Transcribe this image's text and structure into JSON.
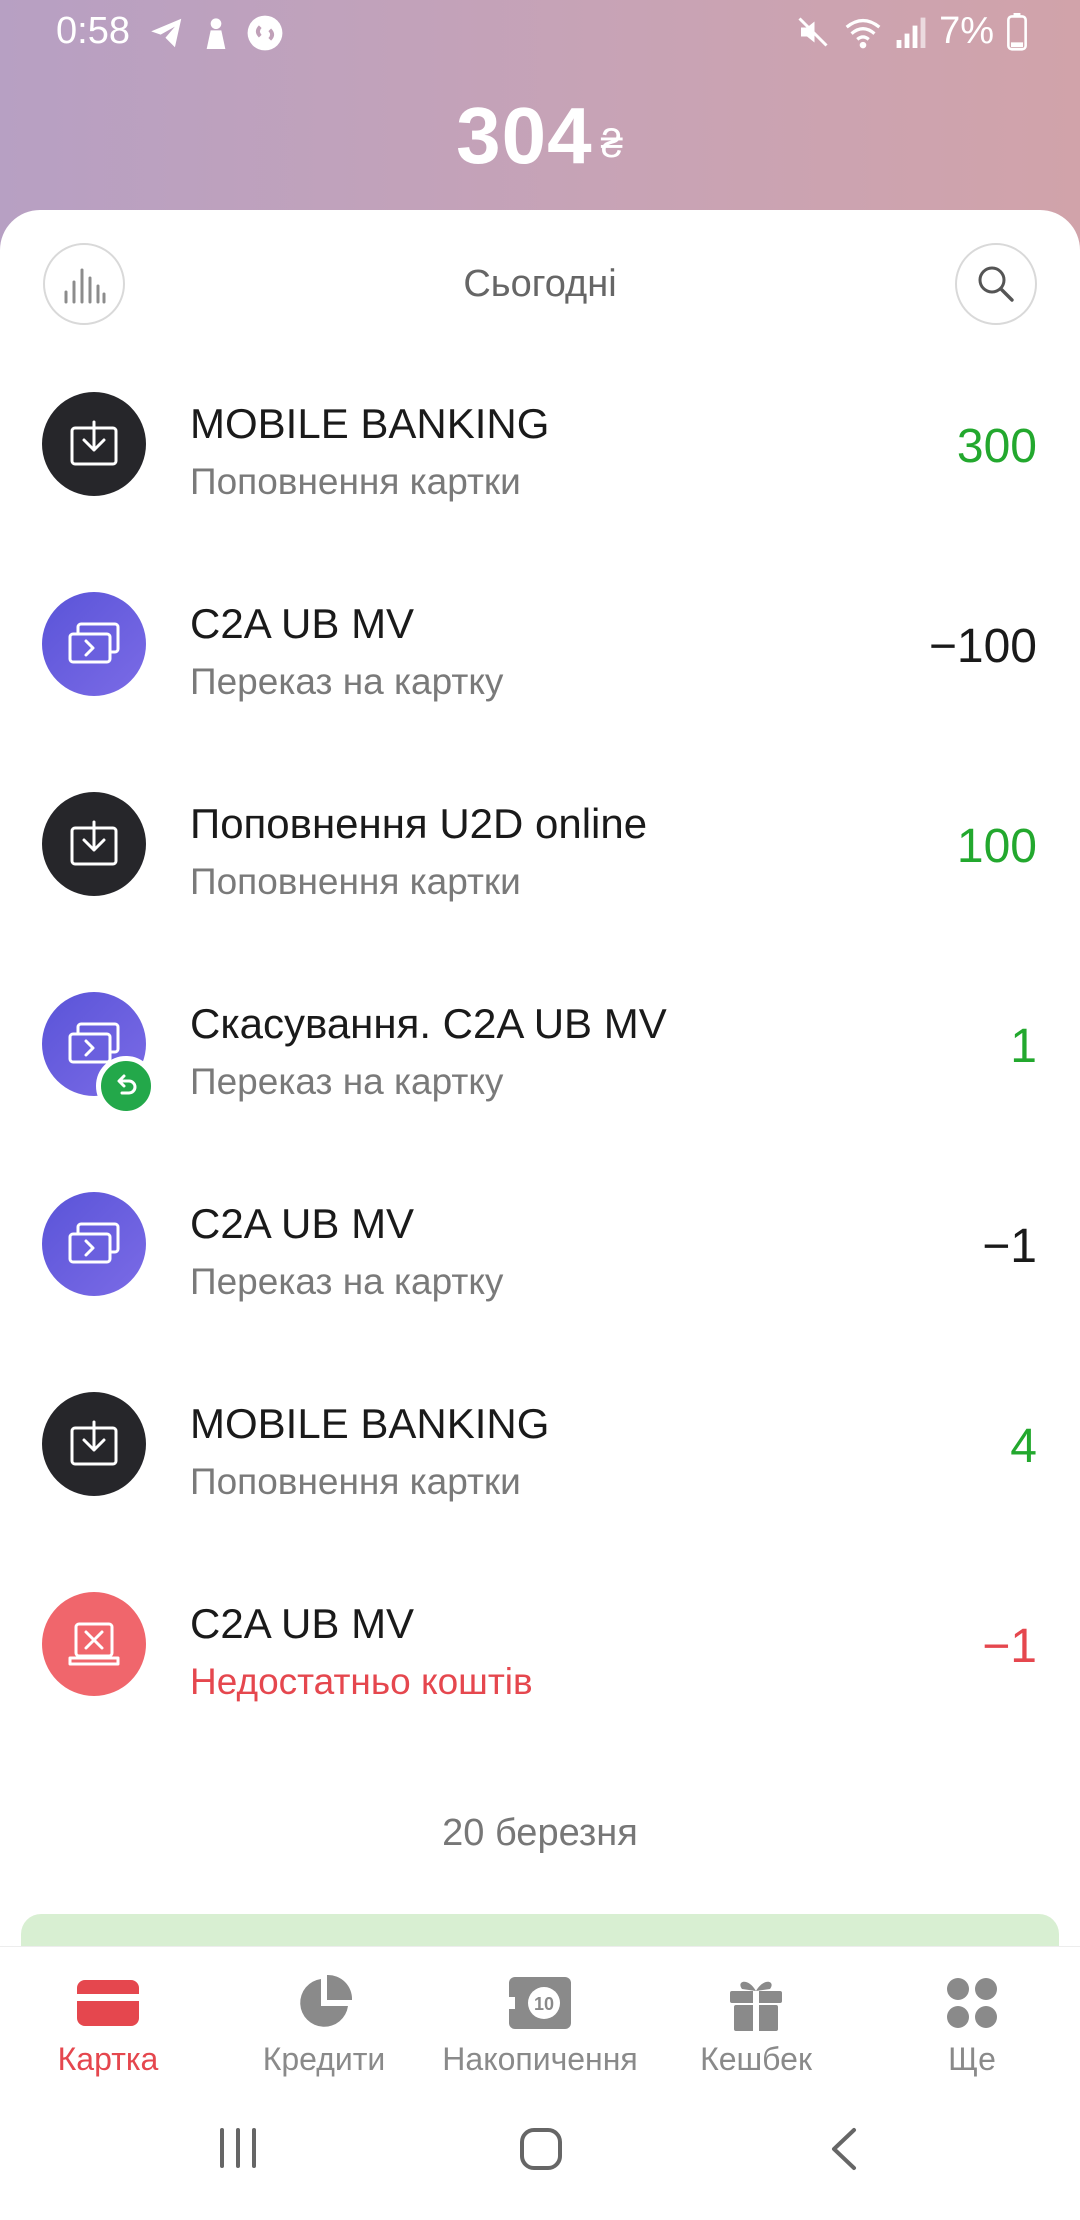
{
  "status_bar": {
    "time": "0:58",
    "battery": "7%"
  },
  "header": {
    "balance": "304",
    "currency": "₴"
  },
  "toolbar": {
    "period_label": "Сьогодні"
  },
  "transactions": [
    {
      "title": "MOBILE BANKING",
      "subtitle": "Поповнення картки",
      "amount": "300",
      "icon": "download-icon",
      "kind": "topup"
    },
    {
      "title": "C2A UB MV",
      "subtitle": "Переказ на картку",
      "amount": "−100",
      "icon": "card-transfer-icon",
      "kind": "transfer"
    },
    {
      "title": "Поповнення U2D online",
      "subtitle": "Поповнення картки",
      "amount": "100",
      "icon": "download-icon",
      "kind": "topup"
    },
    {
      "title": "Скасування. C2A UB MV",
      "subtitle": "Переказ на картку",
      "amount": "1",
      "icon": "card-transfer-icon",
      "kind": "refund"
    },
    {
      "title": "C2A UB MV",
      "subtitle": "Переказ на картку",
      "amount": "−1",
      "icon": "card-transfer-icon",
      "kind": "transfer"
    },
    {
      "title": "MOBILE BANKING",
      "subtitle": "Поповнення картки",
      "amount": "4",
      "icon": "download-icon",
      "kind": "topup"
    },
    {
      "title": "C2A UB MV",
      "subtitle": "Недостатньо коштів",
      "amount": "−1",
      "icon": "declined-icon",
      "kind": "declined"
    }
  ],
  "date_separator": "20 березня",
  "bottom_nav": {
    "items": [
      {
        "label": "Картка",
        "icon": "card-icon",
        "active": true
      },
      {
        "label": "Кредити",
        "icon": "pie-chart-icon",
        "active": false
      },
      {
        "label": "Накопичення",
        "icon": "savings-icon",
        "active": false,
        "icon_text": "10"
      },
      {
        "label": "Кешбек",
        "icon": "gift-icon",
        "active": false
      },
      {
        "label": "Ще",
        "icon": "more-icon",
        "active": false
      }
    ]
  },
  "colors": {
    "accent": "#e5474e",
    "positive": "#23a82e",
    "header_gradient_start": "#b7a0c3",
    "header_gradient_end": "#d1a3aa"
  }
}
